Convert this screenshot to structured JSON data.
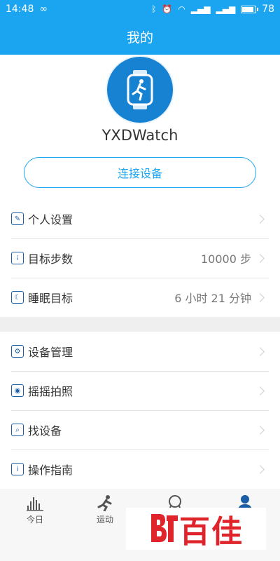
{
  "status_bar": {
    "time": "14:48",
    "battery_level": "78",
    "battery_fraction": 0.78
  },
  "header": {
    "title": "我的"
  },
  "profile": {
    "device_name": "YXDWatch",
    "connect_label": "连接设备"
  },
  "group1": [
    {
      "icon": "person-settings-icon",
      "label": "个人设置",
      "value": ""
    },
    {
      "icon": "footsteps-icon",
      "label": "目标步数",
      "value": "10000 步"
    },
    {
      "icon": "moon-clock-icon",
      "label": "睡眠目标",
      "value": "6 小时 21 分钟"
    }
  ],
  "group2": [
    {
      "icon": "gear-icon",
      "label": "设备管理"
    },
    {
      "icon": "camera-icon",
      "label": "摇摇拍照"
    },
    {
      "icon": "search-icon",
      "label": "找设备"
    },
    {
      "icon": "info-icon",
      "label": "操作指南"
    }
  ],
  "tabs": [
    {
      "icon": "bar-chart-icon",
      "label": "今日"
    },
    {
      "icon": "runner-icon",
      "label": "运动"
    },
    {
      "icon": "badge-icon",
      "label": ""
    },
    {
      "icon": "person-icon",
      "label": ""
    }
  ],
  "colors": {
    "primary": "#1ba4f0",
    "icon_blue": "#1a5fa6",
    "watermark_red": "#e0242b"
  },
  "watermark": {
    "text": "百佳"
  }
}
